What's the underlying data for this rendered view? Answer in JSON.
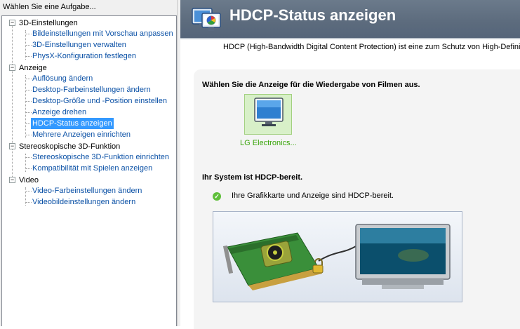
{
  "sidebar": {
    "title": "Wählen Sie eine Aufgabe...",
    "categories": [
      {
        "label": "3D-Einstellungen",
        "items": [
          "Bildeinstellungen mit Vorschau anpassen",
          "3D-Einstellungen verwalten",
          "PhysX-Konfiguration festlegen"
        ]
      },
      {
        "label": "Anzeige",
        "items": [
          "Auflösung ändern",
          "Desktop-Farbeinstellungen ändern",
          "Desktop-Größe und -Position einstellen",
          "Anzeige drehen",
          "HDCP-Status anzeigen",
          "Mehrere Anzeigen einrichten"
        ]
      },
      {
        "label": "Stereoskopische 3D-Funktion",
        "items": [
          "Stereoskopische 3D-Funktion einrichten",
          "Kompatibilität mit Spielen anzeigen"
        ]
      },
      {
        "label": "Video",
        "items": [
          "Video-Farbeinstellungen ändern",
          "Videobildeinstellungen ändern"
        ]
      }
    ],
    "selected": "HDCP-Status anzeigen",
    "toggle_symbol": "−"
  },
  "header": {
    "title": "HDCP-Status anzeigen",
    "icon": "display-settings-icon"
  },
  "main": {
    "description": "HDCP (High-Bandwidth Digital Content Protection) ist eine zum Schutz von High-Definitio",
    "select_display_heading": "Wählen Sie die Anzeige für die Wiedergabe von Filmen aus.",
    "display_label": "LG Electronics...",
    "system_status_heading": "Ihr System ist HDCP-bereit.",
    "status_message": "Ihre Grafikkarte und Anzeige sind HDCP-bereit.",
    "check_glyph": "✓"
  },
  "colors": {
    "link": "#0b51a6",
    "selection": "#3399ff",
    "ok_green": "#3aa50b",
    "header_bg": "#5c6b7d"
  }
}
